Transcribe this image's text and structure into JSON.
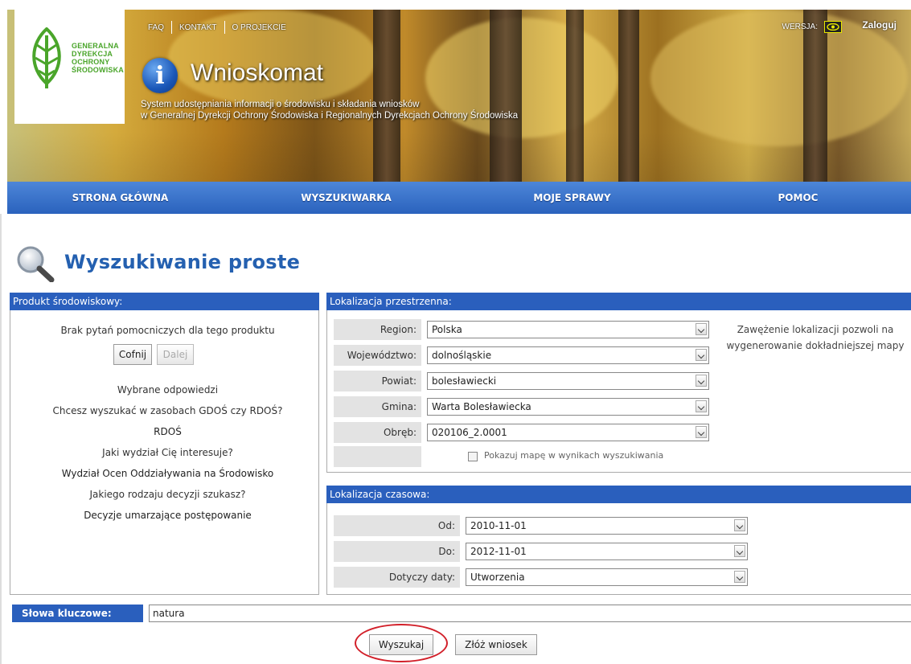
{
  "header": {
    "logo_lines": [
      "GENERALNA",
      "DYREKCJA",
      "OCHRONY",
      "ŚRODOWISKA"
    ],
    "top_links": [
      "FAQ",
      "KONTAKT",
      "O PROJEKCIE"
    ],
    "version_label": "WERSJA:",
    "login": "Zaloguj",
    "app_title": "Wnioskomat",
    "info_glyph": "i",
    "subtitle_line1": "System udostępniania informacji o środowisku i składania wniosków",
    "subtitle_line2": "w Generalnej Dyrekcji Ochrony Środowiska i Regionalnych Dyrekcjach Ochrony Środowiska"
  },
  "nav": [
    "STRONA GŁÓWNA",
    "WYSZUKIWARKA",
    "MOJE SPRAWY",
    "POMOC"
  ],
  "page_title": "Wyszukiwanie proste",
  "product_panel": {
    "title": "Produkt środowiskowy:",
    "no_questions": "Brak pytań pomocniczych dla tego produktu",
    "back_label": "Cofnij",
    "next_label": "Dalej",
    "answers_heading": "Wybrane odpowiedzi",
    "qa": [
      {
        "q": "Chcesz wyszukać w zasobach GDOŚ czy RDOŚ?",
        "a": "RDOŚ"
      },
      {
        "q": "Jaki wydział Cię interesuje?",
        "a": "Wydział Ocen Oddziaływania na Środowisko"
      },
      {
        "q": "Jakiego rodzaju decyzji szukasz?",
        "a": "Decyzje umarzające postępowanie"
      }
    ]
  },
  "location_panel": {
    "title": "Lokalizacja przestrzenna:",
    "rows": [
      {
        "label": "Region:",
        "value": "Polska"
      },
      {
        "label": "Województwo:",
        "value": "dolnośląskie"
      },
      {
        "label": "Powiat:",
        "value": "bolesławiecki"
      },
      {
        "label": "Gmina:",
        "value": "Warta Bolesławiecka"
      },
      {
        "label": "Obręb:",
        "value": "020106_2.0001"
      }
    ],
    "note": "Zawężenie lokalizacji pozwoli na wygenerowanie dokładniejszej mapy",
    "show_map_label": "Pokazuj mapę w wynikach wyszukiwania"
  },
  "time_panel": {
    "title": "Lokalizacja czasowa:",
    "rows": [
      {
        "label": "Od:",
        "value": "2010-11-01"
      },
      {
        "label": "Do:",
        "value": "2012-11-01"
      },
      {
        "label": "Dotyczy daty:",
        "value": "Utworzenia"
      }
    ]
  },
  "keywords": {
    "label": "Słowa kluczowe:",
    "value": "natura"
  },
  "actions": {
    "search": "Wyszukaj",
    "submit": "Złóż wniosek"
  },
  "colors": {
    "brand_blue": "#2a5fbd",
    "title_blue": "#2460b0",
    "highlight_red": "#d2202a",
    "logo_green": "#4aa52a"
  }
}
